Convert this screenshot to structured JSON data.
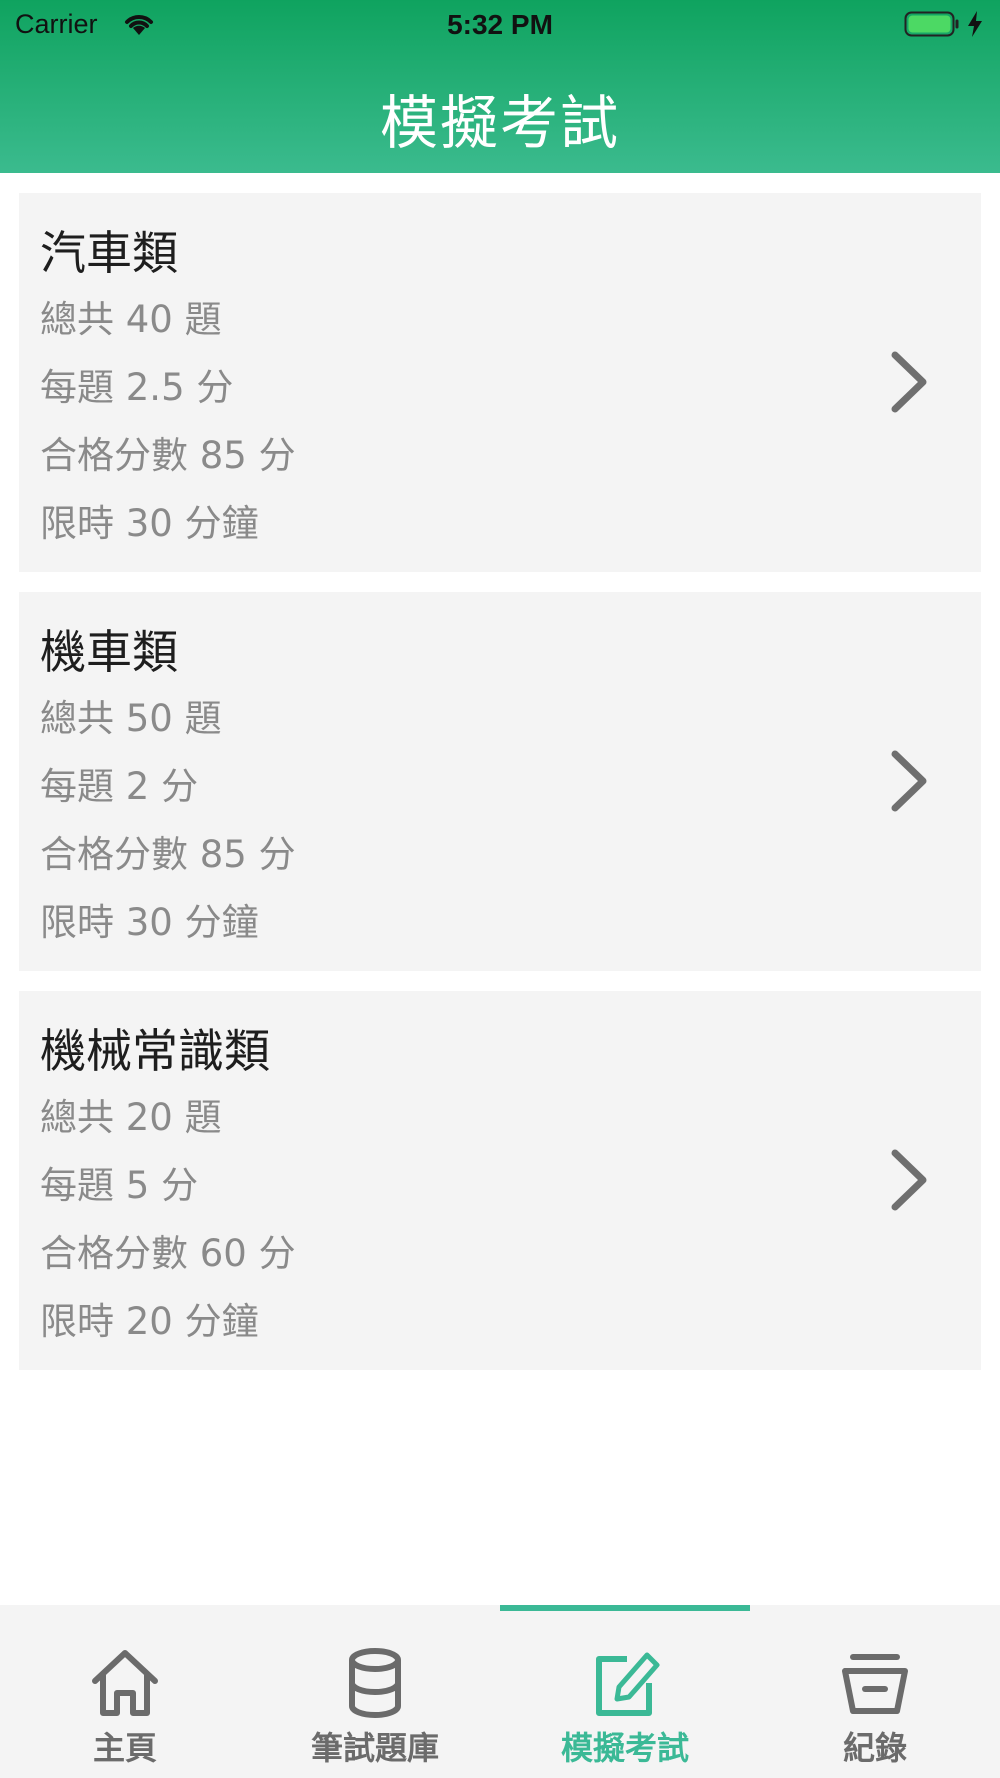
{
  "status_bar": {
    "carrier": "Carrier",
    "time": "5:32 PM"
  },
  "header": {
    "title": "模擬考試"
  },
  "exams": [
    {
      "title": "汽車類",
      "lines": [
        "總共 40 題",
        "每題 2.5 分",
        "合格分數 85 分",
        "限時 30 分鐘"
      ]
    },
    {
      "title": "機車類",
      "lines": [
        "總共 50 題",
        "每題 2 分",
        "合格分數 85 分",
        "限時 30 分鐘"
      ]
    },
    {
      "title": "機械常識類",
      "lines": [
        "總共 20 題",
        "每題 5 分",
        "合格分數 60 分",
        "限時 20 分鐘"
      ]
    }
  ],
  "tabbar": {
    "tabs": [
      {
        "label": "主頁",
        "icon": "home-icon"
      },
      {
        "label": "筆試題庫",
        "icon": "database-icon"
      },
      {
        "label": "模擬考試",
        "icon": "edit-icon"
      },
      {
        "label": "紀錄",
        "icon": "basket-icon"
      }
    ],
    "active_index": 2
  },
  "colors": {
    "header_top": "#0fa35f",
    "header_bottom": "#3bbb8e",
    "accent": "#3bb996",
    "card_bg": "#f4f4f4"
  }
}
